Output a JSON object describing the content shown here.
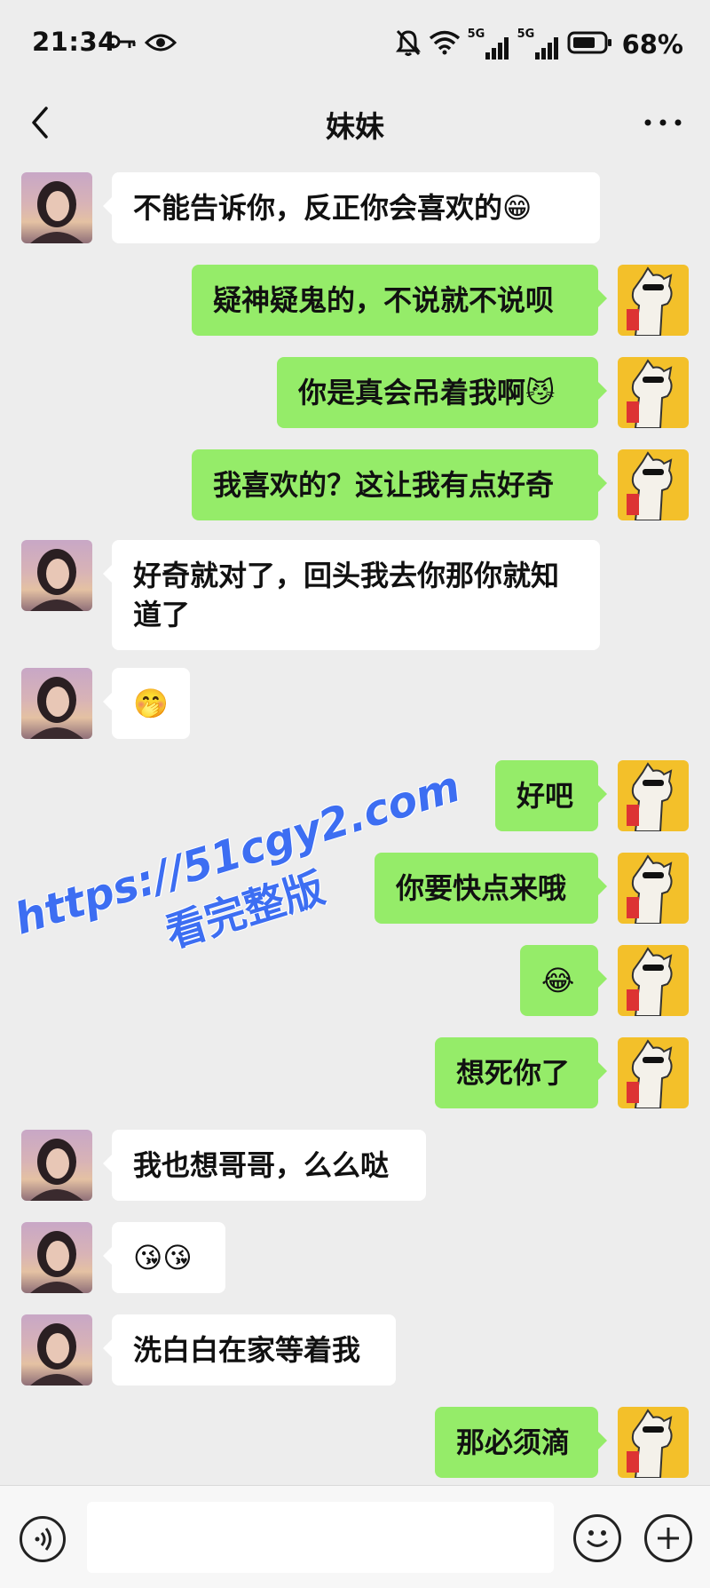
{
  "status_bar": {
    "time": "21:34",
    "network_1": "5G",
    "network_2": "5G",
    "battery": "68%"
  },
  "header": {
    "title": "妹妹"
  },
  "messages": [
    {
      "side": "in",
      "text": "不能告诉你，反正你会喜欢的😁"
    },
    {
      "side": "out",
      "text": "疑神疑鬼的，不说就不说呗"
    },
    {
      "side": "out",
      "text": "你是真会吊着我啊😼"
    },
    {
      "side": "out",
      "text": "我喜欢的？这让我有点好奇"
    },
    {
      "side": "in",
      "text": "好奇就对了，回头我去你那你就知道了"
    },
    {
      "side": "in",
      "text": "🤭"
    },
    {
      "side": "out",
      "text": "好吧"
    },
    {
      "side": "out",
      "text": "你要快点来哦"
    },
    {
      "side": "out",
      "text": "😂"
    },
    {
      "side": "out",
      "text": "想死你了"
    },
    {
      "side": "in",
      "text": "我也想哥哥，么么哒"
    },
    {
      "side": "in",
      "text": "😘😘"
    },
    {
      "side": "in",
      "text": "洗白白在家等着我"
    },
    {
      "side": "out",
      "text": "那必须滴"
    }
  ],
  "watermark": {
    "url": "https://51cgy2.com",
    "subtitle": "看完整版"
  },
  "input": {
    "value": "",
    "placeholder": ""
  },
  "colors": {
    "background": "#ededed",
    "bubble_out": "#95ec69",
    "bubble_in": "#ffffff",
    "watermark": "#3d6ef2"
  },
  "icons": {
    "back": "chevron-left-icon",
    "more": "more-dots-icon",
    "voice": "voice-icon",
    "emoji": "emoji-icon",
    "plus": "plus-icon"
  }
}
